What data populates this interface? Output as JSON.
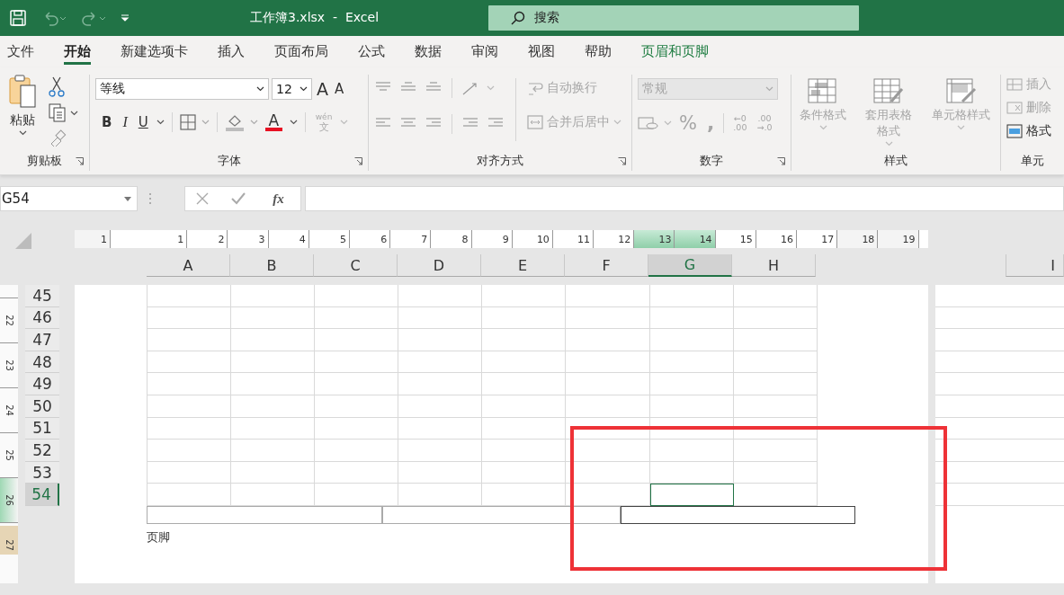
{
  "title_bar": {
    "title": "工作簿3.xlsx  -  Excel",
    "search": {
      "placeholder": "搜索"
    }
  },
  "tabs": [
    {
      "label": "文件",
      "selected": false,
      "kind": "normal"
    },
    {
      "label": "开始",
      "selected": true,
      "kind": "normal"
    },
    {
      "label": "新建选项卡",
      "selected": false,
      "kind": "normal"
    },
    {
      "label": "插入",
      "selected": false,
      "kind": "normal"
    },
    {
      "label": "页面布局",
      "selected": false,
      "kind": "normal"
    },
    {
      "label": "公式",
      "selected": false,
      "kind": "normal"
    },
    {
      "label": "数据",
      "selected": false,
      "kind": "normal"
    },
    {
      "label": "审阅",
      "selected": false,
      "kind": "normal"
    },
    {
      "label": "视图",
      "selected": false,
      "kind": "normal"
    },
    {
      "label": "帮助",
      "selected": false,
      "kind": "normal"
    },
    {
      "label": "页眉和页脚",
      "selected": false,
      "kind": "contextual"
    }
  ],
  "ribbon": {
    "clipboard": {
      "label": "剪贴板",
      "paste": "粘贴"
    },
    "font": {
      "label": "字体",
      "font_name": "等线",
      "font_size": "12",
      "grow": "A",
      "shrink": "A",
      "bold": "B",
      "italic": "I",
      "underline": "U",
      "font_color": "A",
      "phonetic_top": "wén",
      "phonetic_bottom": "文"
    },
    "alignment": {
      "label": "对齐方式",
      "wrap_text": {
        "label": "自动换行",
        "disabled": true
      },
      "merge": {
        "label": "合并后居中",
        "disabled": true
      }
    },
    "number": {
      "label": "数字",
      "format": {
        "value": "常规",
        "disabled": true
      },
      "percent": "%",
      "comma": ",",
      "increase_decimal": [
        "←0",
        ".00"
      ],
      "decrease_decimal": [
        ".00",
        "→.0"
      ]
    },
    "styles": {
      "label": "样式",
      "buttons": [
        {
          "label": "条件格式",
          "disabled": true
        },
        {
          "label": "套用表格格式",
          "disabled": true
        },
        {
          "label": "单元格样式",
          "disabled": true
        }
      ]
    },
    "cells": {
      "label": "单元",
      "buttons": [
        {
          "label": "插入",
          "disabled": true
        },
        {
          "label": "删除",
          "disabled": true
        },
        {
          "label": "格式",
          "disabled": false
        }
      ]
    }
  },
  "formula_bar": {
    "name_box": "G54",
    "function_label": "fx"
  },
  "sheet": {
    "ruler": [
      {
        "label": "1",
        "selected": false
      },
      {
        "label": "1",
        "selected": false
      },
      {
        "label": "2",
        "selected": false
      },
      {
        "label": "3",
        "selected": false
      },
      {
        "label": "4",
        "selected": false
      },
      {
        "label": "5",
        "selected": false
      },
      {
        "label": "6",
        "selected": false
      },
      {
        "label": "7",
        "selected": false
      },
      {
        "label": "8",
        "selected": false
      },
      {
        "label": "9",
        "selected": false
      },
      {
        "label": "10",
        "selected": false
      },
      {
        "label": "11",
        "selected": false
      },
      {
        "label": "12",
        "selected": false
      },
      {
        "label": "13",
        "selected": true
      },
      {
        "label": "14",
        "selected": true
      },
      {
        "label": "15",
        "selected": false
      },
      {
        "label": "16",
        "selected": false
      },
      {
        "label": "17",
        "selected": false
      },
      {
        "label": "18",
        "selected": false
      },
      {
        "label": "19",
        "selected": false
      }
    ],
    "columns": [
      {
        "label": "A",
        "selected": false
      },
      {
        "label": "B",
        "selected": false
      },
      {
        "label": "C",
        "selected": false
      },
      {
        "label": "D",
        "selected": false
      },
      {
        "label": "E",
        "selected": false
      },
      {
        "label": "F",
        "selected": false
      },
      {
        "label": "G",
        "selected": true
      },
      {
        "label": "H",
        "selected": false
      }
    ],
    "next_page_column": {
      "label": "I"
    },
    "side_ruler": [
      {
        "label": "22",
        "selected": false,
        "kind": "body"
      },
      {
        "label": "23",
        "selected": false,
        "kind": "body"
      },
      {
        "label": "24",
        "selected": false,
        "kind": "body"
      },
      {
        "label": "25",
        "selected": false,
        "kind": "body"
      },
      {
        "label": "26",
        "selected": true,
        "kind": "body"
      },
      {
        "label": "27",
        "selected": false,
        "kind": "footer"
      }
    ],
    "rows": [
      {
        "label": "45",
        "selected": false
      },
      {
        "label": "46",
        "selected": false
      },
      {
        "label": "47",
        "selected": false
      },
      {
        "label": "48",
        "selected": false
      },
      {
        "label": "49",
        "selected": false
      },
      {
        "label": "50",
        "selected": false
      },
      {
        "label": "51",
        "selected": false
      },
      {
        "label": "52",
        "selected": false
      },
      {
        "label": "53",
        "selected": false
      },
      {
        "label": "54",
        "selected": true
      }
    ],
    "footer": {
      "label": "页脚",
      "sections": [
        {
          "selected": false
        },
        {
          "selected": false
        },
        {
          "selected": true
        }
      ]
    }
  }
}
